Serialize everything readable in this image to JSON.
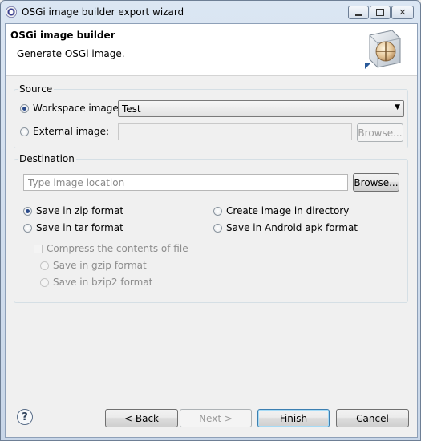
{
  "window": {
    "title": "OSGi image builder export wizard",
    "close_glyph": "✕"
  },
  "header": {
    "title": "OSGi image builder",
    "subtitle": "Generate OSGi image."
  },
  "source": {
    "label": "Source",
    "workspace_label": "Workspace image:",
    "workspace_value": "Test",
    "external_label": "External image:",
    "external_value": "",
    "browse_label": "Browse..."
  },
  "destination": {
    "label": "Destination",
    "location_placeholder": "Type image location",
    "browse_label": "Browse...",
    "zip_label": "Save in zip format",
    "tar_label": "Save in tar format",
    "dir_label": "Create image in directory",
    "apk_label": "Save in Android apk format",
    "compress_label": "Compress the contents of file",
    "gzip_label": "Save in gzip format",
    "bzip2_label": "Save in bzip2 format",
    "selected": "zip"
  },
  "footer": {
    "help_glyph": "?",
    "back_label": "< Back",
    "next_label": "Next >",
    "finish_label": "Finish",
    "cancel_label": "Cancel"
  },
  "icons": {
    "app": "eclipse-icon",
    "banner": "osgi-image-wizard-icon",
    "help": "help-icon",
    "dropdown": "chevron-down-icon"
  }
}
